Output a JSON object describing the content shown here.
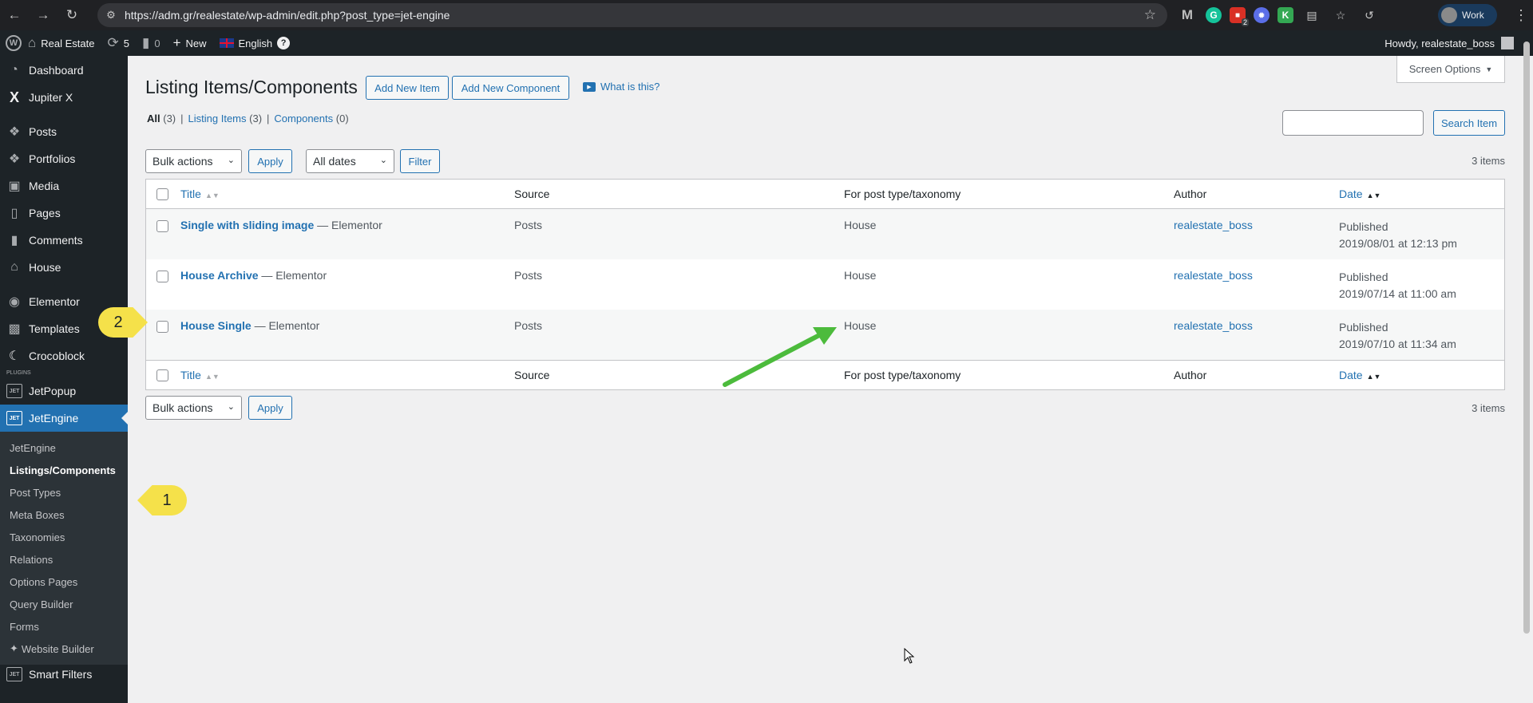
{
  "browser": {
    "url": "https://adm.gr/realestate/wp-admin/edit.php?post_type=jet-engine",
    "profile_name": "Work"
  },
  "adminbar": {
    "site_name": "Real Estate",
    "updates_count": "5",
    "comments_count": "0",
    "new_label": "New",
    "language": "English",
    "help": "?",
    "howdy": "Howdy, realestate_boss"
  },
  "sidebar": {
    "items": [
      {
        "label": "Dashboard",
        "icon": "dashboard-icon"
      },
      {
        "label": "Jupiter X",
        "icon": "jupiter-x-icon"
      },
      {
        "label": "Posts",
        "icon": "pin-icon"
      },
      {
        "label": "Portfolios",
        "icon": "pin-icon"
      },
      {
        "label": "Media",
        "icon": "media-icon"
      },
      {
        "label": "Pages",
        "icon": "pages-icon"
      },
      {
        "label": "Comments",
        "icon": "comment-icon"
      },
      {
        "label": "House",
        "icon": "house-icon"
      },
      {
        "label": "Elementor",
        "icon": "elementor-icon"
      },
      {
        "label": "Templates",
        "icon": "folder-icon"
      },
      {
        "label": "Crocoblock",
        "icon": "crocoblock-icon"
      },
      {
        "label": "JetPopup",
        "icon": "jet-icon"
      },
      {
        "label": "JetEngine",
        "icon": "jet-icon"
      }
    ],
    "plugins_label": "PLUGINS",
    "submenu": [
      "JetEngine",
      "Listings/Components",
      "Post Types",
      "Meta Boxes",
      "Taxonomies",
      "Relations",
      "Options Pages",
      "Query Builder",
      "Forms",
      "Website Builder",
      "Smart Filters"
    ]
  },
  "page": {
    "title": "Listing Items/Components",
    "add_item": "Add New Item",
    "add_component": "Add New Component",
    "what_is_this": "What is this?",
    "screen_options": "Screen Options",
    "filters": {
      "all": "All",
      "all_count": "(3)",
      "listing_items": "Listing Items",
      "listing_items_count": "(3)",
      "components": "Components",
      "components_count": "(0)",
      "sep": "|"
    },
    "search_button": "Search Item",
    "bulk_actions": "Bulk actions",
    "apply": "Apply",
    "all_dates": "All dates",
    "filter": "Filter",
    "items_count": "3 items"
  },
  "table": {
    "headers": {
      "title": "Title",
      "source": "Source",
      "type": "For post type/taxonomy",
      "author": "Author",
      "date": "Date"
    },
    "rows": [
      {
        "title": "Single with sliding image",
        "state": " — Elementor",
        "source": "Posts",
        "type": "House",
        "author": "realestate_boss",
        "status": "Published",
        "date": "2019/08/01 at 12:13 pm"
      },
      {
        "title": "House Archive",
        "state": " — Elementor",
        "source": "Posts",
        "type": "House",
        "author": "realestate_boss",
        "status": "Published",
        "date": "2019/07/14 at 11:00 am"
      },
      {
        "title": "House Single",
        "state": " — Elementor",
        "source": "Posts",
        "type": "House",
        "author": "realestate_boss",
        "status": "Published",
        "date": "2019/07/10 at 11:34 am"
      }
    ]
  },
  "annotations": {
    "marker_1": "1",
    "marker_2": "2",
    "arrow_color": "#4cbb3c",
    "marker_color": "#f5e14a"
  },
  "colors": {
    "accent": "#2271b1",
    "admin_bg": "#1d2327"
  }
}
